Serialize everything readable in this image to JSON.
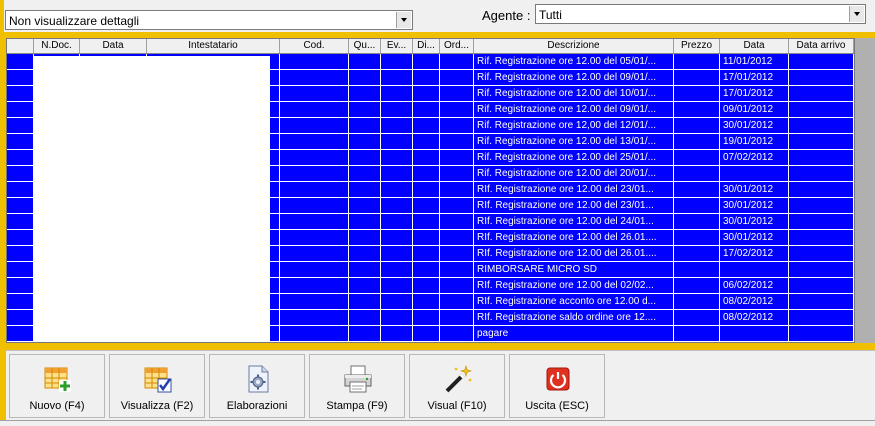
{
  "filters": {
    "detail_select": "Non visualizzare dettagli",
    "agent_label": "Agente :",
    "agent_select": "Tutti"
  },
  "table": {
    "columns": [
      "",
      "N.Doc.",
      "Data",
      "Intestatario",
      "Cod.",
      "Qu...",
      "Ev...",
      "Di...",
      "Ord...",
      "Descrizione",
      "Prezzo",
      "Data",
      "Data arrivo"
    ],
    "rows": [
      {
        "descrizione": "Rif. Registrazione ore 12.00 del 05/01/...",
        "data": "11/01/2012"
      },
      {
        "descrizione": "Rif. Registrazione ore 12.00 del 09/01/...",
        "data": "17/01/2012"
      },
      {
        "descrizione": "Rif. Registrazione ore 12.00 del 10/01/...",
        "data": "17/01/2012"
      },
      {
        "descrizione": "Rif. Registrazione ore 12.00 del 09/01/...",
        "data": "09/01/2012"
      },
      {
        "descrizione": "Rif. Registrazione ore 12,00 del 12/01/...",
        "data": "30/01/2012"
      },
      {
        "descrizione": "Rif. Registrazione ore 12.00 del 13/01/...",
        "data": "19/01/2012"
      },
      {
        "descrizione": "Rif. Registrazione ore 12.00 del 25/01/...",
        "data": "07/02/2012"
      },
      {
        "descrizione": "Rif. Registrazione ore 12.00 del 20/01/...",
        "data": ""
      },
      {
        "descrizione": "RIf. Registrazione ore 12.00 del 23/01...",
        "data": "30/01/2012"
      },
      {
        "descrizione": "RIf. Registrazione ore 12.00 del 23/01...",
        "data": "30/01/2012"
      },
      {
        "descrizione": "RIf. Registrazione ore 12.00 del 24/01...",
        "data": "30/01/2012"
      },
      {
        "descrizione": "RIf. Registrazione ore 12.00 del 26.01....",
        "data": "30/01/2012"
      },
      {
        "descrizione": "RIf. Registrazione ore 12.00 del 26.01....",
        "data": "17/02/2012"
      },
      {
        "descrizione": "RIMBORSARE MICRO SD",
        "data": ""
      },
      {
        "descrizione": "RIf. Registrazione ore 12.00 del 02/02...",
        "data": "06/02/2012"
      },
      {
        "descrizione": "RIf. Registrazione acconto ore 12.00 d...",
        "data": "08/02/2012"
      },
      {
        "descrizione": "RIf. Registrazione saldo ordine ore 12....",
        "data": "08/02/2012"
      },
      {
        "descrizione": "pagare",
        "data": ""
      }
    ]
  },
  "buttons": [
    {
      "label": "Nuovo (F4)",
      "icon": "grid-plus-icon"
    },
    {
      "label": "Visualizza (F2)",
      "icon": "grid-check-icon"
    },
    {
      "label": "Elaborazioni",
      "icon": "document-gear-icon"
    },
    {
      "label": "Stampa (F9)",
      "icon": "printer-icon"
    },
    {
      "label": "Visual (F10)",
      "icon": "magic-wand-icon"
    },
    {
      "label": "Uscita (ESC)",
      "icon": "power-icon"
    }
  ],
  "colors": {
    "grid_bg": "#0000ff",
    "panel_accent": "#f0c000",
    "exit_red": "#e0301e"
  }
}
